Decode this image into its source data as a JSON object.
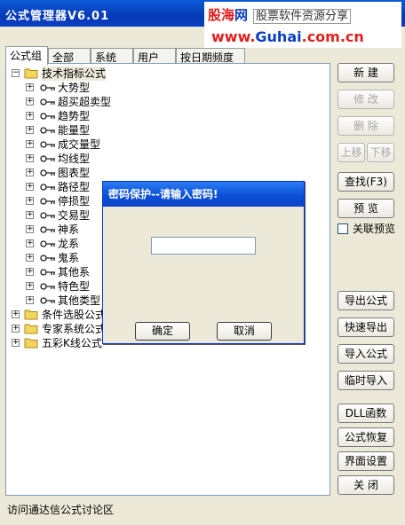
{
  "window": {
    "title": "公式管理器V6.01"
  },
  "watermark": {
    "brand_a": "股海",
    "brand_b": "网",
    "tagline": "股票软件资源分享",
    "url_a": "www.",
    "url_b": "Guhai",
    "url_c": ".com.cn"
  },
  "tabs": [
    "公式组",
    "全部",
    "系统",
    "用户",
    "按日期频度"
  ],
  "tree": {
    "root": "技术指标公式",
    "children": [
      "大势型",
      "超买超卖型",
      "趋势型",
      "能量型",
      "成交量型",
      "均线型",
      "图表型",
      "路径型",
      "停损型",
      "交易型",
      "神系",
      "龙系",
      "鬼系",
      "其他系",
      "特色型",
      "其他类型"
    ],
    "groups": [
      "条件选股公式",
      "专家系统公式",
      "五彩K线公式"
    ]
  },
  "buttons": {
    "new": "新  建",
    "modify": "修  改",
    "delete": "删  除",
    "move_up": "上移",
    "move_down": "下移",
    "find": "查找(F3)",
    "preview": "预  览",
    "linked_preview": "关联预览",
    "export": "导出公式",
    "quick_export": "快速导出",
    "import": "导入公式",
    "temp_import": "临时导入",
    "dll": "DLL函数",
    "restore": "公式恢复",
    "ui_settings": "界面设置",
    "close": "关  闭"
  },
  "status": {
    "text": "访问通达信公式讨论区"
  },
  "dialog": {
    "title": "密码保护--请输入密码!",
    "password_value": "",
    "ok": "确定",
    "cancel": "取消"
  },
  "colors": {
    "title_blue": "#0a3fc2",
    "window_bg": "#ece9d8",
    "brand_red": "#e21b1b"
  }
}
